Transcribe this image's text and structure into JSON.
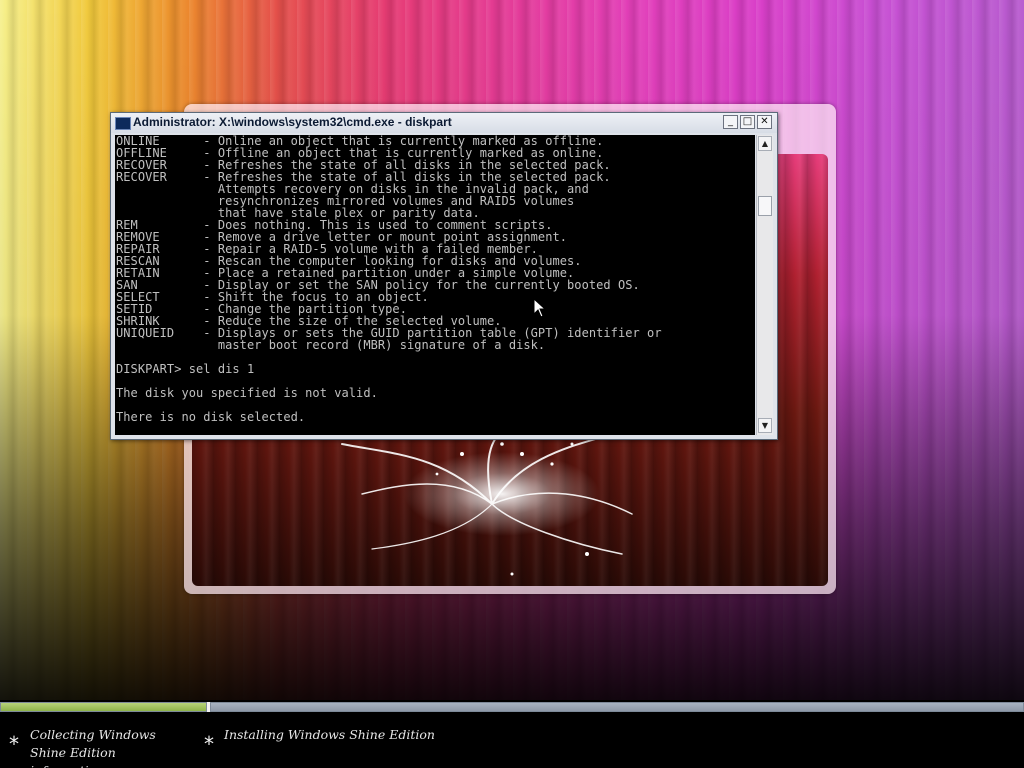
{
  "cmd_window": {
    "title": "Administrator: X:\\windows\\system32\\cmd.exe - diskpart",
    "buttons": {
      "minimize": "_",
      "maximize": "□",
      "close": "✕"
    },
    "icon": "console-icon",
    "output": "ONLINE      - Online an object that is currently marked as offline.\nOFFLINE     - Offline an object that is currently marked as online.\nRECOVER     - Refreshes the state of all disks in the selected pack.\nRECOVER     - Refreshes the state of all disks in the selected pack.\n              Attempts recovery on disks in the invalid pack, and\n              resynchronizes mirrored volumes and RAID5 volumes\n              that have stale plex or parity data.\nREM         - Does nothing. This is used to comment scripts.\nREMOVE      - Remove a drive letter or mount point assignment.\nREPAIR      - Repair a RAID-5 volume with a failed member.\nRESCAN      - Rescan the computer looking for disks and volumes.\nRETAIN      - Place a retained partition under a simple volume.\nSAN         - Display or set the SAN policy for the currently booted OS.\nSELECT      - Shift the focus to an object.\nSETID       - Change the partition type.\nSHRINK      - Reduce the size of the selected volume.\nUNIQUEID    - Displays or sets the GUID partition table (GPT) identifier or\n              master boot record (MBR) signature of a disk.\n\nDISKPART> sel dis 1\n\nThe disk you specified is not valid.\n\nThere is no disk selected."
  },
  "scrollbar": {
    "up_arrow": "▲",
    "down_arrow": "▼"
  },
  "progress": {
    "step1_fraction": 1.0,
    "step2_fraction": 0.0
  },
  "steps": [
    {
      "bullet": "*",
      "label": "Collecting Windows Shine Edition information"
    },
    {
      "bullet": "*",
      "label": "Installing Windows Shine Edition"
    }
  ],
  "colors": {
    "console_text": "#c0c0c0",
    "console_bg": "#000000",
    "progress_done": "#8fb34a",
    "progress_track": "#7d8a99"
  }
}
